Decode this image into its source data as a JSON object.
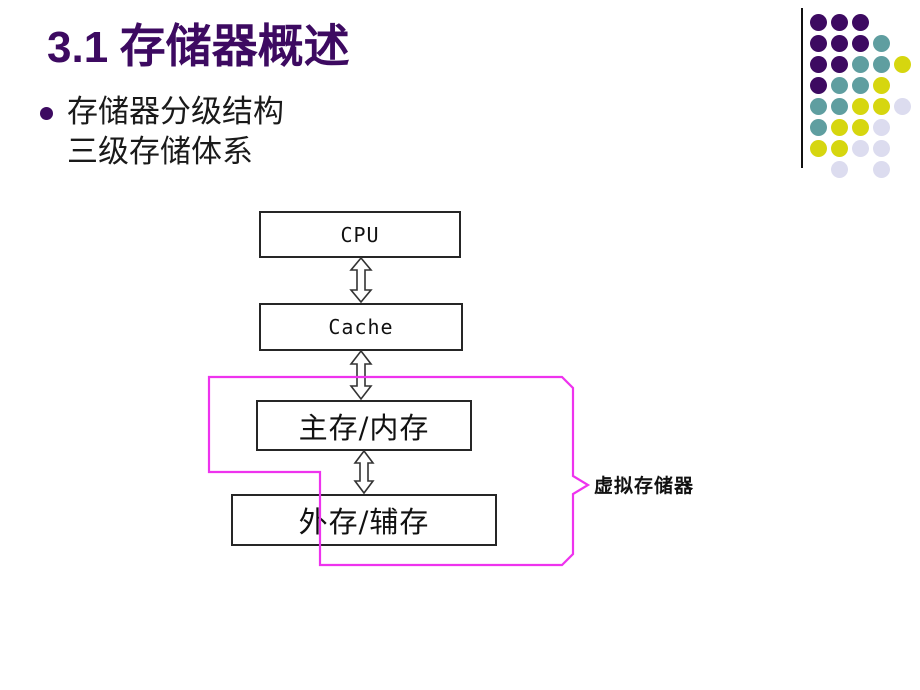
{
  "slide": {
    "title": {
      "number": "3.1",
      "heading": "存储器概述",
      "color": "#3d0a61"
    },
    "bullet": {
      "marker": "filled-round-bullet",
      "lines": [
        "存储器分级结构",
        "三级存储体系"
      ]
    }
  },
  "diagram": {
    "type": "three-level-memory-hierarchy",
    "boxes": [
      {
        "id": "cpu",
        "label": "CPU",
        "script": "latin"
      },
      {
        "id": "cache",
        "label": "Cache",
        "script": "latin"
      },
      {
        "id": "main",
        "label": "主存/内存",
        "script": "cjk"
      },
      {
        "id": "ext",
        "label": "外存/辅存",
        "script": "cjk"
      }
    ],
    "connectors": [
      {
        "from": "cpu",
        "to": "cache",
        "style": "double-headed-outline-arrow"
      },
      {
        "from": "cache",
        "to": "main",
        "style": "double-headed-outline-arrow"
      },
      {
        "from": "main",
        "to": "ext",
        "style": "double-headed-outline-arrow"
      }
    ],
    "annotation": {
      "label": "虚拟存储器",
      "color": "#ee33ee",
      "encloses": [
        "main",
        "ext"
      ],
      "shape": "brace-outline"
    },
    "line_color": "#262626"
  },
  "decoration": {
    "rule": {
      "color": "#111111"
    },
    "dot_grid": {
      "colors": {
        "purple": "#3d0a61",
        "teal": "#5f9ea0",
        "yellow": "#d6d60f",
        "pale": "#dcdcef"
      },
      "cell": 21,
      "rows": [
        [
          "purple",
          "purple",
          "purple",
          null,
          null
        ],
        [
          "purple",
          "purple",
          "purple",
          "teal",
          null
        ],
        [
          "purple",
          "purple",
          "teal",
          "teal",
          "yellow"
        ],
        [
          "purple",
          "teal",
          "teal",
          "yellow",
          null
        ],
        [
          "teal",
          "teal",
          "yellow",
          "yellow",
          "pale"
        ],
        [
          "teal",
          "yellow",
          "yellow",
          "pale",
          null
        ],
        [
          "yellow",
          "yellow",
          "pale",
          "pale",
          null
        ],
        [
          null,
          "pale",
          null,
          "pale",
          null
        ]
      ]
    }
  }
}
